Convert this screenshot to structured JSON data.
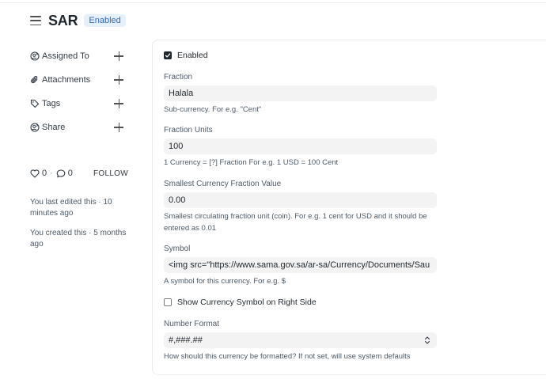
{
  "header": {
    "title": "SAR",
    "status_badge": "Enabled"
  },
  "sidebar": {
    "items": [
      {
        "label": "Assigned To",
        "icon": "user-plus-icon"
      },
      {
        "label": "Attachments",
        "icon": "paperclip-icon"
      },
      {
        "label": "Tags",
        "icon": "tag-icon"
      },
      {
        "label": "Share",
        "icon": "share-icon"
      }
    ],
    "likes": "0",
    "comments": "0",
    "separator": "·",
    "follow_label": "FOLLOW",
    "activity": [
      "You last edited this · 10 minutes ago",
      "You created this · 5 months ago"
    ]
  },
  "form": {
    "enabled": {
      "label": "Enabled",
      "checked": true
    },
    "fraction": {
      "label": "Fraction",
      "value": "Halala",
      "description": "Sub-currency. For e.g. \"Cent\""
    },
    "fraction_units": {
      "label": "Fraction Units",
      "value": "100",
      "description": "1 Currency = [?] Fraction For e.g. 1 USD = 100 Cent"
    },
    "smallest_fraction": {
      "label": "Smallest Currency Fraction Value",
      "value": "0.00",
      "description": "Smallest circulating fraction unit (coin). For e.g. 1 cent for USD and it should be entered as 0.01"
    },
    "symbol": {
      "label": "Symbol",
      "value": "<img src=\"https://www.sama.gov.sa/ar-sa/Currency/Documents/Sau",
      "description": "A symbol for this currency. For e.g. $"
    },
    "symbol_right": {
      "label": "Show Currency Symbol on Right Side",
      "checked": false
    },
    "number_format": {
      "label": "Number Format",
      "value": "#,###.##",
      "description": "How should this currency be formatted? If not set, will use system defaults"
    }
  },
  "colors": {
    "badge_bg": "#e6f0fb",
    "badge_text": "#2f6bb8",
    "input_bg": "#f3f3f3",
    "text": "#1f272e",
    "muted": "#4c5a67"
  }
}
